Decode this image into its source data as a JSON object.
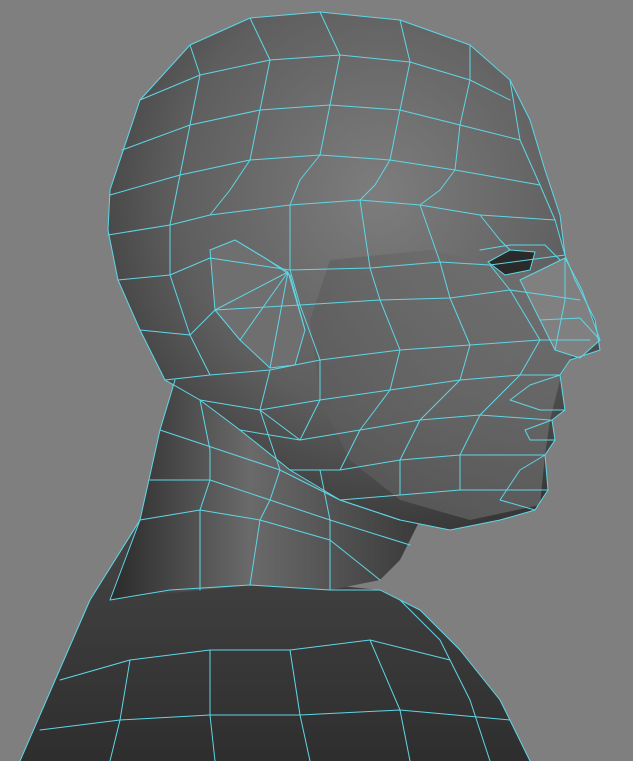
{
  "viewport": {
    "background_color": "#7f7f7f",
    "wireframe_color": "#5fd6e6",
    "shading_light": "#8e8e8e",
    "shading_dark": "#2a2a2a",
    "subject": "polygon-head-model-wireframe-on-shaded",
    "view": "side-profile-right"
  }
}
